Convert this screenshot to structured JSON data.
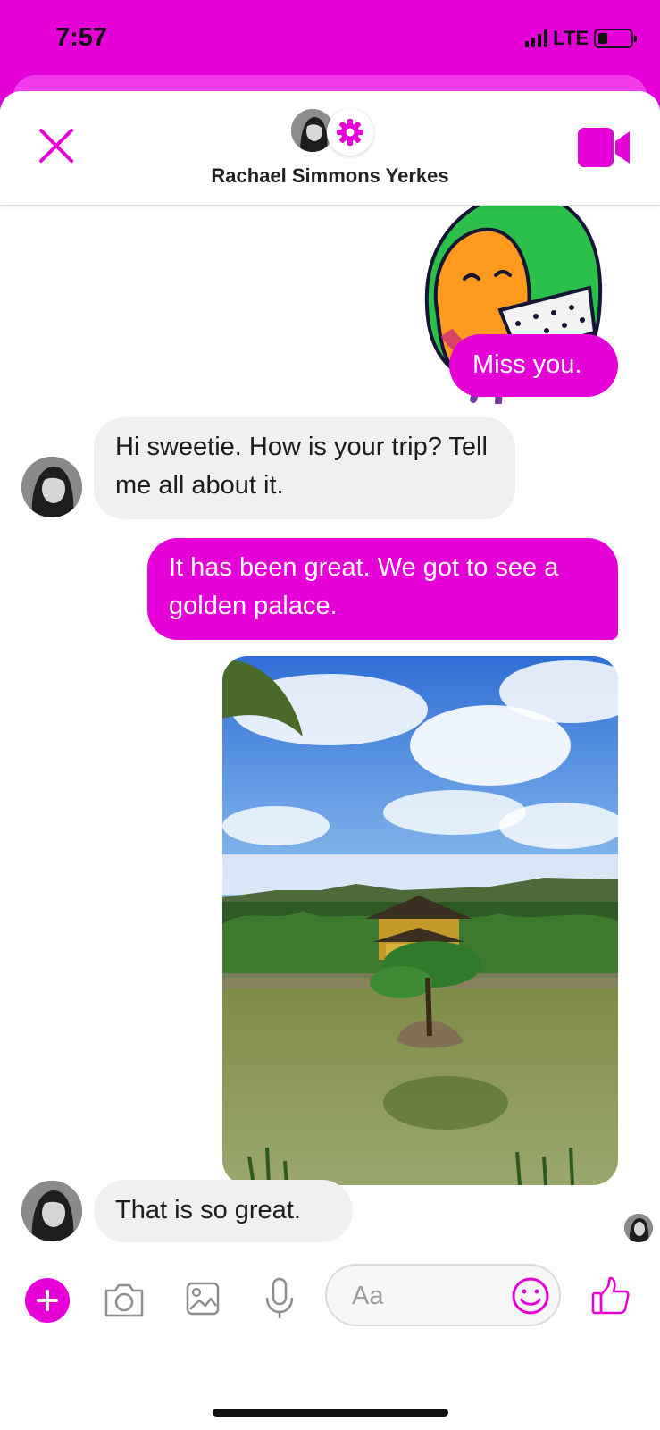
{
  "status_bar": {
    "time": "7:57",
    "network": "LTE"
  },
  "header": {
    "contact_name": "Rachael Simmons Yerkes",
    "close_icon": "close-icon",
    "settings_icon": "gear-icon",
    "video_icon": "video-call-icon"
  },
  "messages": [
    {
      "type": "sticker",
      "from": "me",
      "description_icon": "hug-sticker"
    },
    {
      "type": "text",
      "from": "me",
      "text": "Miss you."
    },
    {
      "type": "text",
      "from": "them",
      "text": "Hi sweetie. How is your trip? Tell me all about it."
    },
    {
      "type": "text",
      "from": "me",
      "text": "It has been great. We got to see a golden palace."
    },
    {
      "type": "photo",
      "from": "me"
    },
    {
      "type": "text",
      "from": "them",
      "text": "That is so great."
    }
  ],
  "composer": {
    "placeholder": "Aa",
    "icons": [
      "plus-icon",
      "camera-icon",
      "image-icon",
      "microphone-icon",
      "emoji-icon",
      "thumbs-up-icon"
    ]
  },
  "colors": {
    "accent": "#e600d8",
    "bubble_them": "#f0f0f0",
    "background": "#ffffff"
  }
}
